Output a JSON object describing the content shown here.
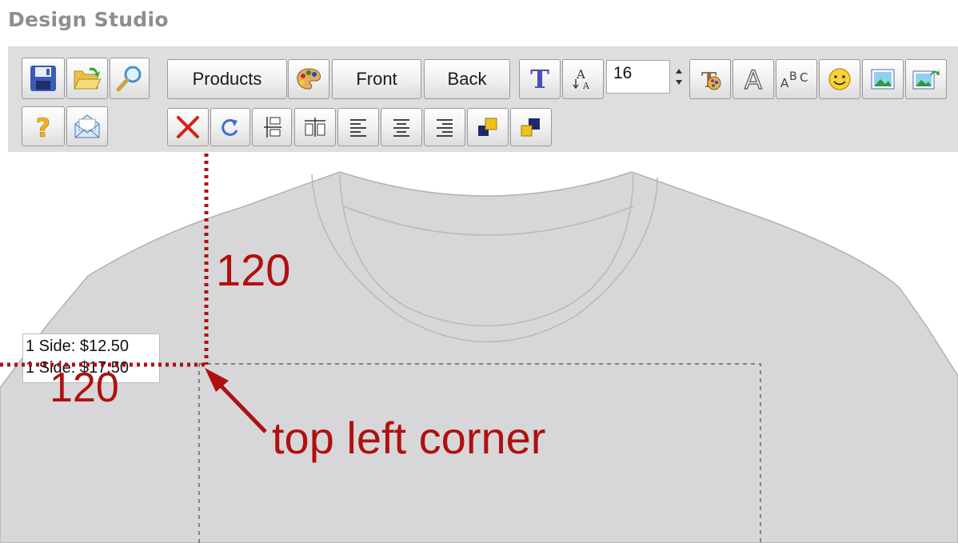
{
  "app": {
    "title": "Design Studio"
  },
  "toolbar": {
    "row1": {
      "save": "save-icon",
      "open": "open-folder-icon",
      "zoom": "magnifier-icon",
      "products_label": "Products",
      "palette": "palette-icon",
      "front_label": "Front",
      "back_label": "Back",
      "add_text": "text-T-icon",
      "text_size": "font-size-icon",
      "font_size_value": "16",
      "text_color": "text-color-icon",
      "outline": "outline-A-icon",
      "arc_text": "arc-text-icon",
      "clipart": "smiley-icon",
      "image": "image-icon",
      "upload_image": "upload-image-icon"
    },
    "row2": {
      "help": "question-mark-icon",
      "email": "envelope-icon",
      "delete": "delete-x-icon",
      "rotate": "rotate-icon",
      "center_vertical": "center-vertical-icon",
      "center_horizontal": "center-horizontal-icon",
      "align_left": "align-left-icon",
      "align_center": "align-center-icon",
      "align_right": "align-right-icon",
      "bring_forward": "bring-forward-icon",
      "send_backward": "send-backward-icon"
    }
  },
  "pricing": {
    "line1": "1 Side: $12.50",
    "line2": "1 Side: $17.50"
  },
  "annotations": {
    "top_offset": "120",
    "left_offset": "120",
    "corner_label": "top left corner"
  },
  "colors": {
    "annotation": "#b01010",
    "shirt": "#d7d7da",
    "toolbar_bg": "#dedede",
    "title": "#8e8e8e"
  }
}
